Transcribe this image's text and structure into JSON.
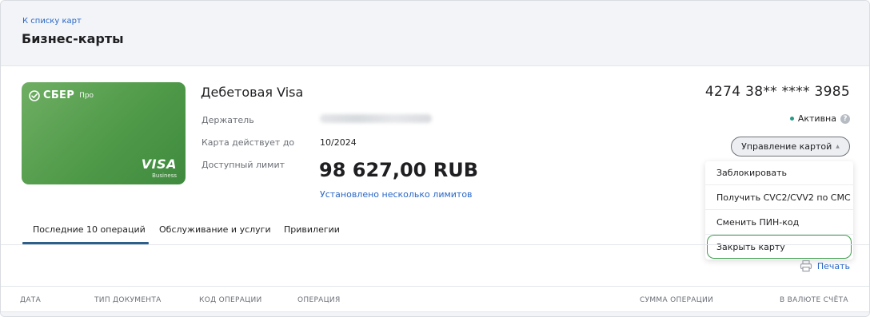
{
  "header": {
    "back_link": "К списку карт",
    "title": "Бизнес-карты"
  },
  "card_image": {
    "bank_name": "СБЕР",
    "bank_suffix": "Про",
    "network": "VISA",
    "network_sub": "Business",
    "accent": "#4f9a49"
  },
  "card": {
    "type": "Дебетовая Visa",
    "number": "4274 38** **** 3985",
    "holder_label": "Держатель",
    "valid_label": "Карта действует до",
    "valid_value": "10/2024",
    "limit_label": "Доступный лимит",
    "limit_value": "98 627,00 RUB",
    "limits_link": "Установлено несколько лимитов",
    "status": "Активна",
    "status_color": "#2b9a86",
    "help": "?"
  },
  "manage": {
    "label": "Управление картой",
    "menu": [
      "Заблокировать",
      "Получить CVC2/CVV2 по СМС",
      "Сменить ПИН-код",
      "Закрыть карту"
    ]
  },
  "tabs": [
    "Последние 10 операций",
    "Обслуживание и услуги",
    "Привилегии"
  ],
  "print_label": "Печать",
  "table": {
    "columns": [
      "ДАТА",
      "ТИП ДОКУМЕНТА",
      "КОД ОПЕРАЦИИ",
      "ОПЕРАЦИЯ",
      "СУММА ОПЕРАЦИИ",
      "В ВАЛЮТЕ СЧЁТА"
    ]
  }
}
